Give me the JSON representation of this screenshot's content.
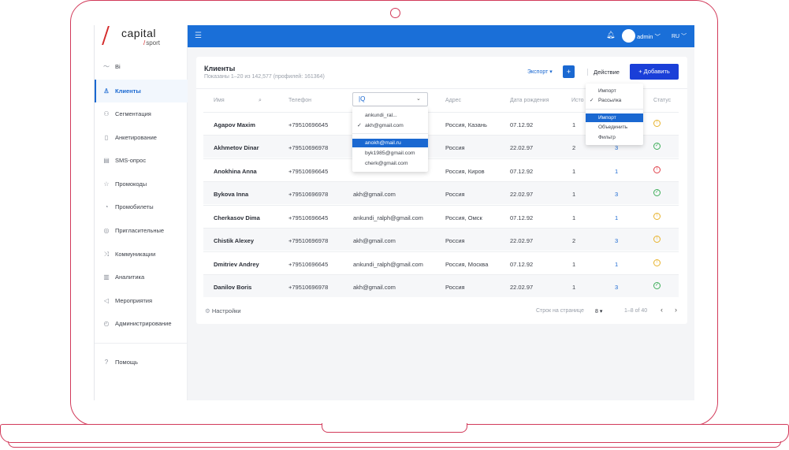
{
  "brand": {
    "name": "capital",
    "sub": "sport"
  },
  "topbar": {
    "user": "admin",
    "lang": "RU"
  },
  "sidebar": {
    "items": [
      {
        "label": "Bi",
        "icon": "trend-icon"
      },
      {
        "label": "Клиенты",
        "icon": "user-icon",
        "active": true
      },
      {
        "label": "Сегментация",
        "icon": "hierarchy-icon"
      },
      {
        "label": "Анкетирование",
        "icon": "form-icon"
      },
      {
        "label": "SMS-опрос",
        "icon": "sms-icon"
      },
      {
        "label": "Промокоды",
        "icon": "star-icon"
      },
      {
        "label": "Промобилеты",
        "icon": "ticket-icon"
      },
      {
        "label": "Пригласительные",
        "icon": "invite-icon"
      },
      {
        "label": "Коммуникации",
        "icon": "shuffle-icon"
      },
      {
        "label": "Аналитика",
        "icon": "bars-icon"
      },
      {
        "label": "Мероприятия",
        "icon": "megaphone-icon"
      },
      {
        "label": "Администрирование",
        "icon": "gauge-icon"
      }
    ],
    "help": "Помощь"
  },
  "page": {
    "title": "Клиенты",
    "subtitle": "Показаны 1–20 из 142,577 (профилей: 161364)",
    "export": "Экспорт",
    "plus": "+",
    "action": "Действие",
    "add": "+ Добавить"
  },
  "table": {
    "headers": {
      "name": "Имя",
      "phone": "Телефон",
      "address": "Адрес",
      "birth": "Дата рождения",
      "history": "Исто",
      "status": "Статус"
    },
    "rows": [
      {
        "name": "Agapov Maxim",
        "phone": "+79510696645",
        "email": "",
        "address": "Россия, Казань",
        "birth": "07.12.92",
        "a": "1",
        "b": "",
        "status": "warn"
      },
      {
        "name": "Akhmetov Dinar",
        "phone": "+79510696978",
        "email": "",
        "address": "Россия",
        "birth": "22.02.97",
        "a": "2",
        "b": "3",
        "status": "ok"
      },
      {
        "name": "Anokhina Anna",
        "phone": "+79510696645",
        "email": "",
        "address": "Россия, Киров",
        "birth": "07.12.92",
        "a": "1",
        "b": "1",
        "status": "err"
      },
      {
        "name": "Bykova Inna",
        "phone": "+79510696978",
        "email": "akh@gmail.com",
        "address": "Россия",
        "birth": "22.02.97",
        "a": "1",
        "b": "3",
        "status": "ok"
      },
      {
        "name": "Cherkasov Dima",
        "phone": "+79510696645",
        "email": "ankundi_ralph@gmail.com",
        "address": "Россия, Омск",
        "birth": "07.12.92",
        "a": "1",
        "b": "1",
        "status": "warn"
      },
      {
        "name": "Chistik Alexey",
        "phone": "+79510696978",
        "email": "akh@gmail.com",
        "address": "Россия",
        "birth": "22.02.97",
        "a": "2",
        "b": "3",
        "status": "warn"
      },
      {
        "name": "Dmitriev Andrey",
        "phone": "+79510696645",
        "email": "ankundi_ralph@gmail.com",
        "address": "Россия, Москва",
        "birth": "07.12.92",
        "a": "1",
        "b": "1",
        "status": "warn"
      },
      {
        "name": "Danilov Boris",
        "phone": "+79510696978",
        "email": "akh@gmail.com",
        "address": "Россия",
        "birth": "22.02.97",
        "a": "1",
        "b": "3",
        "status": "ok"
      }
    ]
  },
  "footer": {
    "settings": "Настройки",
    "rows_label": "Строк на странице",
    "rows_value": "8",
    "range": "1–8 of 40"
  },
  "email_dropdown": {
    "search_value": "|Q",
    "items": [
      "ankundi_ral...",
      "akh@gmail.com",
      "anokh@mail.ru",
      "byk1985@gmail.com",
      "cherk@gmail.com"
    ]
  },
  "action_menu": {
    "items": [
      "Импорт",
      "Рассылка",
      "Импорт",
      "Объединить",
      "Фильтр"
    ]
  }
}
